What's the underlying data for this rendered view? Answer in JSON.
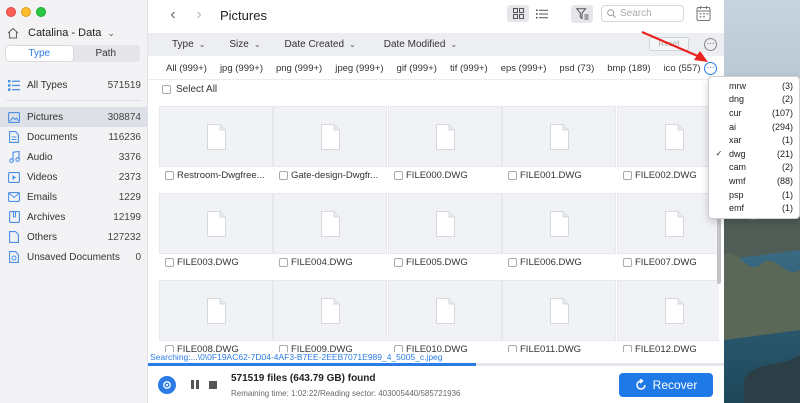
{
  "sidebar": {
    "disk_name": "Catalina - Data",
    "tabs": [
      {
        "label": "Type"
      },
      {
        "label": "Path"
      }
    ],
    "all_types": {
      "label": "All Types",
      "count": "571519"
    },
    "items": [
      {
        "label": "Pictures",
        "count": "308874",
        "icon": "picture-icon"
      },
      {
        "label": "Documents",
        "count": "116236",
        "icon": "document-icon"
      },
      {
        "label": "Audio",
        "count": "3376",
        "icon": "audio-icon"
      },
      {
        "label": "Videos",
        "count": "2373",
        "icon": "video-icon"
      },
      {
        "label": "Emails",
        "count": "1229",
        "icon": "email-icon"
      },
      {
        "label": "Archives",
        "count": "12199",
        "icon": "archive-icon"
      },
      {
        "label": "Others",
        "count": "127232",
        "icon": "others-icon"
      },
      {
        "label": "Unsaved Documents",
        "count": "0",
        "icon": "unsaved-doc-icon"
      }
    ]
  },
  "toolbar": {
    "title": "Pictures",
    "search_placeholder": "Search",
    "back_icon": "chevron-left-icon",
    "forward_icon": "chevron-right-icon"
  },
  "filters": {
    "dropdowns": [
      {
        "label": "Type"
      },
      {
        "label": "Size"
      },
      {
        "label": "Date Created"
      },
      {
        "label": "Date Modified"
      }
    ],
    "reset_label": "Reset"
  },
  "extensions": [
    {
      "label": "All (999+)"
    },
    {
      "label": "jpg (999+)"
    },
    {
      "label": "png (999+)"
    },
    {
      "label": "jpeg (999+)"
    },
    {
      "label": "gif (999+)"
    },
    {
      "label": "tif (999+)"
    },
    {
      "label": "eps (999+)"
    },
    {
      "label": "psd (73)"
    },
    {
      "label": "bmp (189)"
    },
    {
      "label": "ico (557)"
    }
  ],
  "select_all_label": "Select All",
  "files": [
    {
      "name": "Restroom-Dwgfree..."
    },
    {
      "name": "Gate-design-Dwgfr..."
    },
    {
      "name": "FILE000.DWG"
    },
    {
      "name": "FILE001.DWG"
    },
    {
      "name": "FILE002.DWG"
    },
    {
      "name": "FILE003.DWG"
    },
    {
      "name": "FILE004.DWG"
    },
    {
      "name": "FILE005.DWG"
    },
    {
      "name": "FILE006.DWG"
    },
    {
      "name": "FILE007.DWG"
    },
    {
      "name": "FILE008.DWG"
    },
    {
      "name": "FILE009.DWG"
    },
    {
      "name": "FILE010.DWG"
    },
    {
      "name": "FILE011.DWG"
    },
    {
      "name": "FILE012.DWG"
    }
  ],
  "status": {
    "searching": "Searching:...\\0\\0F19AC62-7D04-4AF3-B7EE-2EEB7071E989_4_5005_c.jpeg",
    "progress": 0.57,
    "found": "571519 files (643.79 GB) found",
    "remaining": "Remaining time: 1:02:22/Reading sector: 403005440/585721936"
  },
  "recover_label": "Recover",
  "popup": {
    "items": [
      {
        "name": "mrw",
        "count": "(3)",
        "checked": false
      },
      {
        "name": "dng",
        "count": "(2)",
        "checked": false
      },
      {
        "name": "cur",
        "count": "(107)",
        "checked": false
      },
      {
        "name": "ai",
        "count": "(294)",
        "checked": false
      },
      {
        "name": "xar",
        "count": "(1)",
        "checked": false
      },
      {
        "name": "dwg",
        "count": "(21)",
        "checked": true
      },
      {
        "name": "cam",
        "count": "(2)",
        "checked": false
      },
      {
        "name": "wmf",
        "count": "(88)",
        "checked": false
      },
      {
        "name": "psp",
        "count": "(1)",
        "checked": false
      },
      {
        "name": "emf",
        "count": "(1)",
        "checked": false
      }
    ]
  },
  "colors": {
    "accent": "#1f7ae8",
    "annotation_arrow": "#e8231f"
  }
}
